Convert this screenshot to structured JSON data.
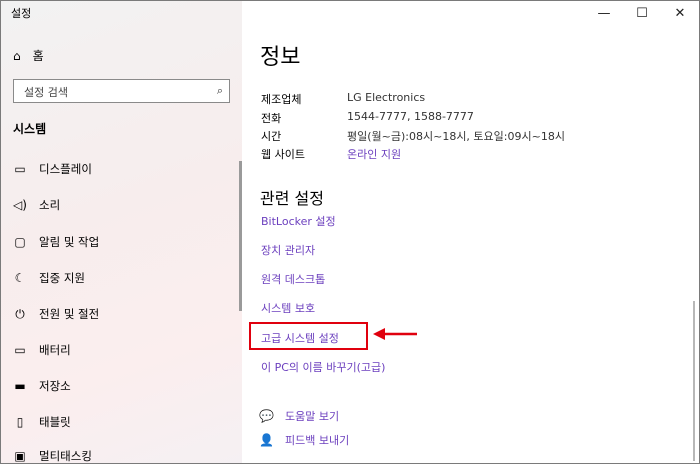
{
  "window": {
    "title": "설정",
    "minimize": "—",
    "maximize": "☐",
    "close": "✕"
  },
  "sidebar": {
    "home_label": "홈",
    "search_placeholder": "설정 검색",
    "section": "시스템",
    "items": [
      {
        "label": "디스플레이",
        "icon": "display-icon"
      },
      {
        "label": "소리",
        "icon": "speaker-icon"
      },
      {
        "label": "알림 및 작업",
        "icon": "notification-icon"
      },
      {
        "label": "집중 지원",
        "icon": "moon-icon"
      },
      {
        "label": "전원 및 절전",
        "icon": "power-icon"
      },
      {
        "label": "배터리",
        "icon": "battery-icon"
      },
      {
        "label": "저장소",
        "icon": "storage-icon"
      },
      {
        "label": "태블릿",
        "icon": "tablet-icon"
      },
      {
        "label": "멀티태스킹",
        "icon": "multitasking-icon"
      }
    ]
  },
  "main": {
    "title": "정보",
    "info": [
      {
        "key": "제조업체",
        "value": "LG Electronics"
      },
      {
        "key": "전화",
        "value": "1544-7777, 1588-7777"
      },
      {
        "key": "시간",
        "value": "평일(월~금):08시~18시, 토요일:09시~18시"
      },
      {
        "key": "웹 사이트",
        "value": "온라인 지원"
      }
    ],
    "related_title": "관련 설정",
    "related_links": [
      "BitLocker 설정",
      "장치 관리자",
      "원격 데스크톱",
      "시스템 보호",
      "고급 시스템 설정",
      "이 PC의 이름 바꾸기(고급)"
    ],
    "help": [
      {
        "label": "도움말 보기",
        "icon": "help-chat-icon"
      },
      {
        "label": "피드백 보내기",
        "icon": "feedback-icon"
      }
    ]
  },
  "annotation_color": "#e0000e"
}
